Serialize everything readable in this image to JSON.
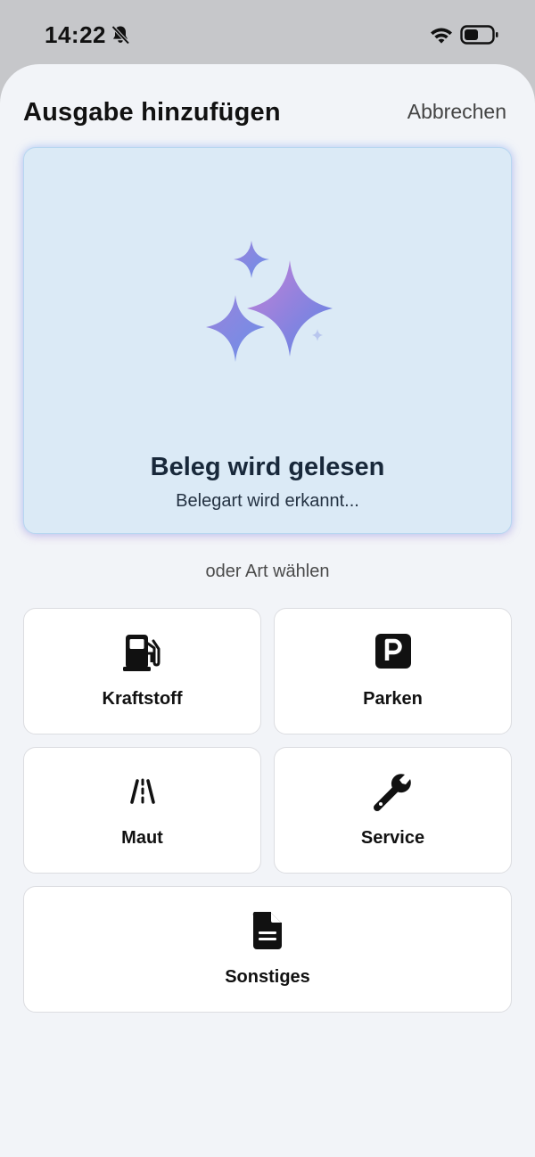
{
  "status_bar": {
    "time": "14:22",
    "icons": [
      "bell-slash-icon",
      "wifi-icon",
      "battery-icon"
    ]
  },
  "header": {
    "title": "Ausgabe hinzufügen",
    "cancel_label": "Abbrechen"
  },
  "scan": {
    "icon": "sparkles-icon",
    "title": "Beleg wird gelesen",
    "subtitle": "Belegart wird erkannt..."
  },
  "divider_label": "oder Art wählen",
  "categories": [
    {
      "label": "Kraftstoff",
      "icon": "fuel-pump-icon"
    },
    {
      "label": "Parken",
      "icon": "parking-icon"
    },
    {
      "label": "Maut",
      "icon": "road-icon"
    },
    {
      "label": "Service",
      "icon": "wrench-icon"
    },
    {
      "label": "Sonstiges",
      "icon": "document-icon"
    }
  ],
  "colors": {
    "scan_card_bg": "#dbeaf6",
    "sheet_bg": "#f2f4f8",
    "sparkle_purple": "#b07ad6",
    "sparkle_blue": "#5a86e6"
  }
}
